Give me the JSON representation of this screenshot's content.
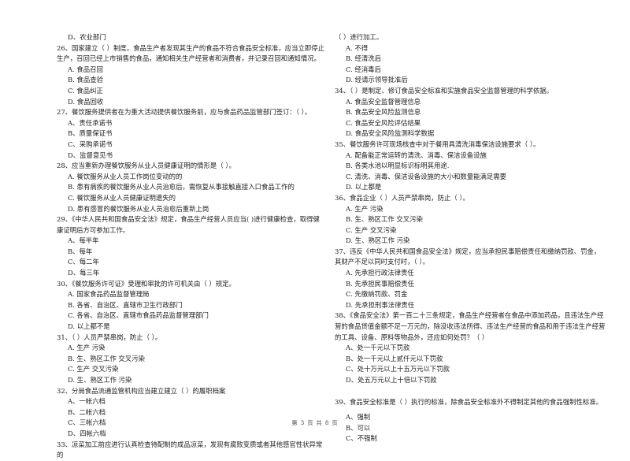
{
  "page": {
    "footer": "第 3 页 共 8 页"
  },
  "left": {
    "prev_tail": [
      "D、农业部门"
    ],
    "questions": [
      {
        "stem": "26、国家建立（      ）制度。食品生产者发现其生产的食品不符合食品安全标准，应当立即停止生产，召回已经上市销售的食品，通知相关生产经营者和消费者，并记录召回和通知情况。",
        "options": [
          "A. 食品召回",
          "B. 食品查验",
          "C. 食品纠正",
          "D. 食品回收"
        ]
      },
      {
        "stem": "27、餐饮服务提供者在为重大活动提供餐饮服务前，应与食品药品监管部门签订：（      ）。",
        "options": [
          "A、责任承诺书",
          "B、质量保证书",
          "C、采购承诺书",
          "D、监督意见书"
        ]
      },
      {
        "stem": "28、应当重新办理餐饮服务从业人员健康证明的情形是（      ）。",
        "options": [
          "A. 餐饮服务从业人员工作岗位变动的的",
          "B. 患有病疾的餐饮服务从业人员治愈后，需恢复从事接触直接入口食品工作的",
          "C. 餐饮服务从业人员健康证明遗失的",
          "D. 患有感冒的餐饮服务从业人员治愈后重新上岗"
        ]
      },
      {
        "stem": "29、《中华人民共和国食品安全法》规定，食品生产经营人员应当(            )进行健康检查，取得健康证明后方可参加工作。",
        "options": [
          "A、每半年",
          "B、每年",
          "C、每二年",
          "D、每三年"
        ]
      },
      {
        "stem": "30、《餐饮服务许可证》受理和审批的许可机关由（      ）规定。",
        "options": [
          "A. 国家食品药品监督管理局",
          "B. 各省、自治区、直辖市卫生行政部门",
          "C. 各省、自治区、直辖市食品药品监督管理部门",
          "D. 以上都不是"
        ]
      },
      {
        "stem": "31、（      ）人员严禁串岗，防止（      ）。",
        "options": [
          "A. 生产  污染",
          "B. 生、熟区工作  交叉污染",
          "C. 生产  交叉污染",
          "D. 生、熟区工作  污染"
        ]
      },
      {
        "stem": "32、分局食品流通监管机构应当建立建立（      ）的履职档案",
        "options": [
          "A、一帐六档",
          "B、二帐六档",
          "C、三帐六档",
          "D、四帐六档"
        ]
      },
      {
        "stem": "33、凉菜加工前应进行认真检查待配制的成品凉菜，发现有腐败变质或者其他感官性状异常的",
        "options": []
      }
    ]
  },
  "right": {
    "prev_tail_stem": "（      ）进行加工。",
    "prev_tail_options": [
      "A. 不得",
      "B. 经清洗后",
      "C. 经消毒后",
      "D. 经请示领导批准后"
    ],
    "questions": [
      {
        "stem": "34、（      ）是制定、修订食品安全标准和实施食品安全监督管理的科学依据。",
        "options": [
          "A. 食品安全监督管理信息",
          "B. 食品安全风险监测信息",
          "C. 食品安全风险评估结果",
          "D. 食品安全风险监测科学数据"
        ]
      },
      {
        "stem": "35、餐饮服务许可现场核查中对于餐用具清洗消毒保洁设施要求（      ）。",
        "options": [
          "A. 配备能正常运转的清洗、消毒、保洁设备设施",
          "B. 各类水池以明显标识标明其用途.",
          "C. 清洗、消毒、保洁设备设施的大小和数量能满足需要",
          "D. 以上都是"
        ]
      },
      {
        "stem": "36、食品企业（      ）人员严禁串岗，防止（      ）。",
        "options": [
          "A. 生产  污染",
          "B. 生、熟区工作  交叉污染",
          "C. 生产  交叉污染",
          "D. 生、熟区工作  污染"
        ]
      },
      {
        "stem": "37、违反《中华人民共和国食品安全法》规定，应当承担民事赔偿责任和缴纳罚款、罚金，其财产不足以同时支付时，（      ）。",
        "options": [
          "A. 先承担行政法律责任",
          "B. 先承担民事赔偿责任",
          "C. 先缴纳罚款、罚金",
          "D. 先承担刑事法律责任"
        ]
      },
      {
        "stem": "38、《食品安全法》第一百二十三条规定，食品生产经营者在食品中添加药品，且违法生产经营的食品货值金额不足一万元的，除没收违法所得、违法生产经营的食品和用于违法生产经营的工具、设备、原料等物品外，还应如何处罚？（   ）",
        "options": [
          "A、处一千元以下罚款",
          "B、处一千元以上贰仟元以下罚款",
          "C、处十万元以上十五万元以下罚款",
          "D、处五万元以上十倍以下罚款"
        ]
      },
      {
        "stem": "39、食品安全标准是（      ）执行的标准，除食品安全标准外不得制定其他的食品强制性标准。",
        "options": [
          "A、强制",
          "B、可以",
          "C、不强制"
        ]
      }
    ]
  }
}
